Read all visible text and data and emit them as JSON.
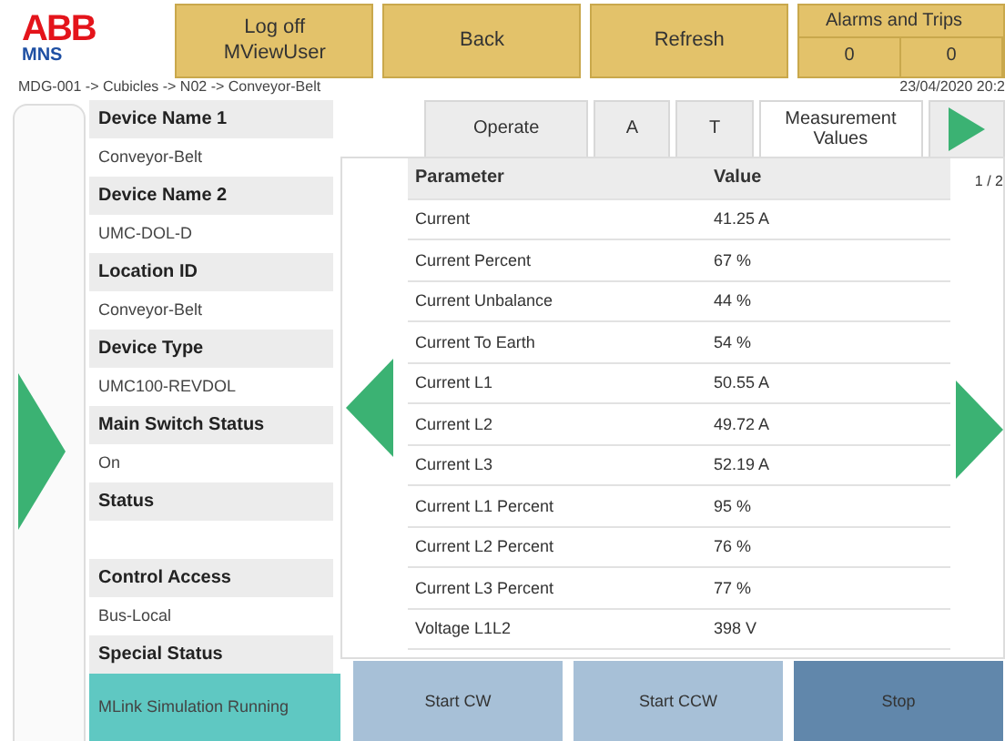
{
  "logo": {
    "brand": "ABB",
    "product": "MNS"
  },
  "header_buttons": [
    {
      "label": "Log off\nMViewUser"
    },
    {
      "label": "Back"
    },
    {
      "label": "Refresh"
    }
  ],
  "alarms": {
    "title": "Alarms and Trips",
    "counts": [
      "0",
      "0"
    ]
  },
  "breadcrumb": "MDG-001 -> Cubicles -> N02 -> Conveyor-Belt",
  "timestamp": "23/04/2020 20:2",
  "device_info": [
    {
      "label": "Device Name 1",
      "value": "Conveyor-Belt"
    },
    {
      "label": "Device Name 2",
      "value": "UMC-DOL-D"
    },
    {
      "label": "Location ID",
      "value": "Conveyor-Belt"
    },
    {
      "label": "Device Type",
      "value": "UMC100-REVDOL"
    },
    {
      "label": "Main Switch Status",
      "value": "On"
    },
    {
      "label": "Status"
    },
    {
      "label": "Control Access",
      "value": "Bus-Local"
    },
    {
      "label": "Special Status",
      "value": "MLink Simulation Running",
      "highlight": true
    }
  ],
  "tabs": [
    {
      "kind": "text",
      "label": "Operate",
      "selected": false
    },
    {
      "kind": "text",
      "label": "A",
      "selected": false
    },
    {
      "kind": "text",
      "label": "T",
      "selected": false
    },
    {
      "kind": "text",
      "label": "Measurement\nValues",
      "selected": true
    },
    {
      "kind": "next",
      "selected": false
    }
  ],
  "page_indicator": "1 / 2",
  "table": {
    "columns": [
      "Parameter",
      "Value"
    ],
    "rows": [
      [
        "Current",
        "41.25 A"
      ],
      [
        "Current Percent",
        "67 %"
      ],
      [
        "Current Unbalance",
        "44 %"
      ],
      [
        "Current To Earth",
        "54 %"
      ],
      [
        "Current L1",
        "50.55 A"
      ],
      [
        "Current L2",
        "49.72 A"
      ],
      [
        "Current L3",
        "52.19 A"
      ],
      [
        "Current L1 Percent",
        "95 %"
      ],
      [
        "Current L2 Percent",
        "76 %"
      ],
      [
        "Current L3 Percent",
        "77 %"
      ],
      [
        "Voltage L1L2",
        "398 V"
      ]
    ]
  },
  "action_buttons": [
    {
      "label": "Start CW",
      "kind": "light"
    },
    {
      "label": "Start CCW",
      "kind": "light"
    },
    {
      "label": "Stop",
      "kind": "dark"
    }
  ]
}
